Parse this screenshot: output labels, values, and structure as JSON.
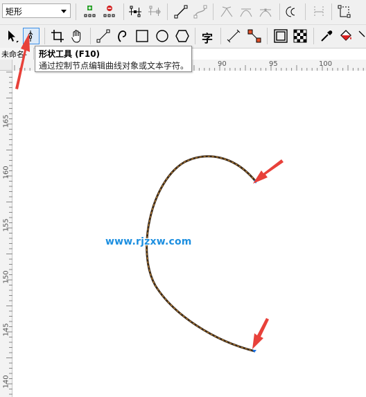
{
  "property_bar": {
    "object_type": "矩形"
  },
  "tooltip": {
    "title": "形状工具 (F10)",
    "description": "通过控制节点编辑曲线对象或文本字符。"
  },
  "document_tab": {
    "label": "未命名-"
  },
  "ruler_top": {
    "labels": [
      "90",
      "95",
      "100"
    ]
  },
  "ruler_left": {
    "labels": [
      "165",
      "160",
      "155",
      "150",
      "145",
      "140"
    ]
  },
  "toolbox": {
    "text_tool_glyph": "字"
  },
  "watermark": "www.rjzxw.com",
  "colors": {
    "toolbar_bg": "#f0f0f0",
    "curve_outline": "#3b2a1a",
    "curve_dash": "#e09a3a",
    "arrow_red": "#e8413a",
    "node_blue": "#1a73e8",
    "watermark": "#1d8fe0"
  },
  "icons": {
    "row1": [
      "add-node-icon",
      "delete-node-icon",
      "join-nodes-icon",
      "break-curve-icon",
      "to-line-icon",
      "to-curve-icon",
      "cusp-node-icon",
      "smooth-node-icon",
      "symmetric-node-icon",
      "reverse-direction-icon",
      "extract-subpath-icon",
      "close-curve-icon"
    ],
    "row2": [
      "pick-tool-icon",
      "shape-tool-icon",
      "crop-tool-icon",
      "pan-tool-icon",
      "freehand-tool-icon",
      "artistic-media-icon",
      "rectangle-tool-icon",
      "ellipse-tool-icon",
      "polygon-tool-icon",
      "text-tool-icon",
      "parallel-dimension-icon",
      "connector-tool-icon",
      "drop-shadow-icon",
      "transparency-icon",
      "eyedropper-icon",
      "fill-tool-icon"
    ]
  }
}
